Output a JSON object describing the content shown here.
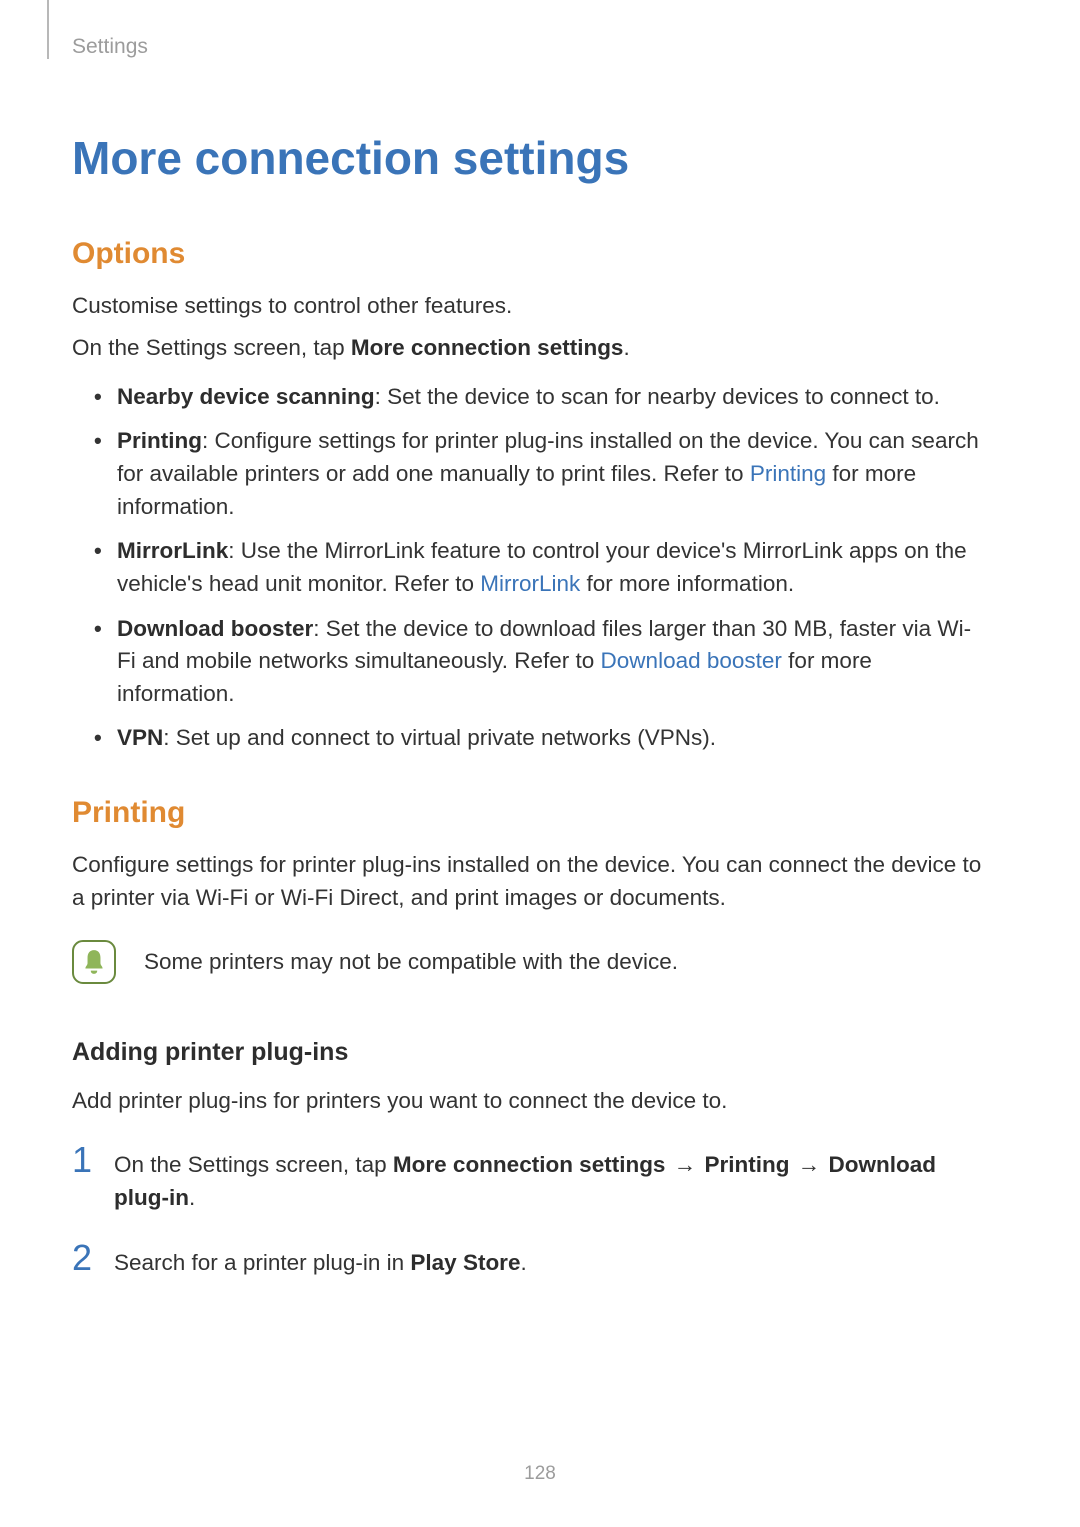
{
  "breadcrumb": "Settings",
  "title": "More connection settings",
  "options": {
    "heading": "Options",
    "intro1": "Customise settings to control other features.",
    "intro2_a": "On the Settings screen, tap ",
    "intro2_b": "More connection settings",
    "intro2_c": ".",
    "items": [
      {
        "label": "Nearby device scanning",
        "text": ": Set the device to scan for nearby devices to connect to."
      },
      {
        "label": "Printing",
        "text_a": ": Configure settings for printer plug-ins installed on the device. You can search for available printers or add one manually to print files. Refer to ",
        "link": "Printing",
        "text_b": " for more information."
      },
      {
        "label": "MirrorLink",
        "text_a": ": Use the MirrorLink feature to control your device's MirrorLink apps on the vehicle's head unit monitor. Refer to ",
        "link": "MirrorLink",
        "text_b": " for more information."
      },
      {
        "label": "Download booster",
        "text_a": ": Set the device to download files larger than 30 MB, faster via Wi-Fi and mobile networks simultaneously. Refer to ",
        "link": "Download booster",
        "text_b": " for more information."
      },
      {
        "label": "VPN",
        "text": ": Set up and connect to virtual private networks (VPNs)."
      }
    ]
  },
  "printing": {
    "heading": "Printing",
    "intro": "Configure settings for printer plug-ins installed on the device. You can connect the device to a printer via Wi-Fi or Wi-Fi Direct, and print images or documents.",
    "note": "Some printers may not be compatible with the device.",
    "sub_heading": "Adding printer plug-ins",
    "sub_intro": "Add printer plug-ins for printers you want to connect the device to.",
    "steps": [
      {
        "num": "1",
        "a": "On the Settings screen, tap ",
        "b1": "More connection settings",
        "arrow1": " → ",
        "b2": "Printing",
        "arrow2": " → ",
        "b3": "Download plug-in",
        "c": "."
      },
      {
        "num": "2",
        "a": "Search for a printer plug-in in ",
        "b1": "Play Store",
        "c": "."
      }
    ]
  },
  "page_number": "128"
}
